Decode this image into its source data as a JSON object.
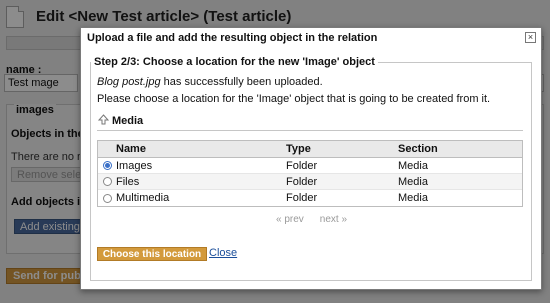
{
  "background": {
    "title": "Edit <New Test article> (Test article)",
    "name_label": "name :",
    "name_value": "Test mage",
    "images_legend": "images",
    "objects_heading": "Objects in the re",
    "no_relations_text": "There are no rela",
    "remove_button": "Remove selec",
    "add_heading": "Add objects in",
    "add_existing_button": "Add existing o",
    "send_button": "Send for publ"
  },
  "modal": {
    "title": "Upload a file and add the resulting object in the relation",
    "close_glyph": "×",
    "step_legend": "Step 2/3: Choose a location for the new 'Image' object",
    "uploaded_file": "Blog post.jpg",
    "uploaded_suffix": " has successfully been uploaded.",
    "choose_text": "Please choose a location for the 'Image' object that is going to be created from it.",
    "breadcrumb": "Media",
    "table": {
      "headers": {
        "name": "Name",
        "type": "Type",
        "section": "Section"
      },
      "rows": [
        {
          "name": "Images",
          "type": "Folder",
          "section": "Media",
          "selected": true
        },
        {
          "name": "Files",
          "type": "Folder",
          "section": "Media",
          "selected": false
        },
        {
          "name": "Multimedia",
          "type": "Folder",
          "section": "Media",
          "selected": false
        }
      ]
    },
    "pager": {
      "prev": "« prev",
      "next": "next »"
    },
    "choose_button": "Choose this location",
    "close_link": "Close"
  },
  "colors": {
    "accent_button": "#d39a3c",
    "link": "#1b4e9a",
    "radio_selected": "#3a70c8"
  }
}
